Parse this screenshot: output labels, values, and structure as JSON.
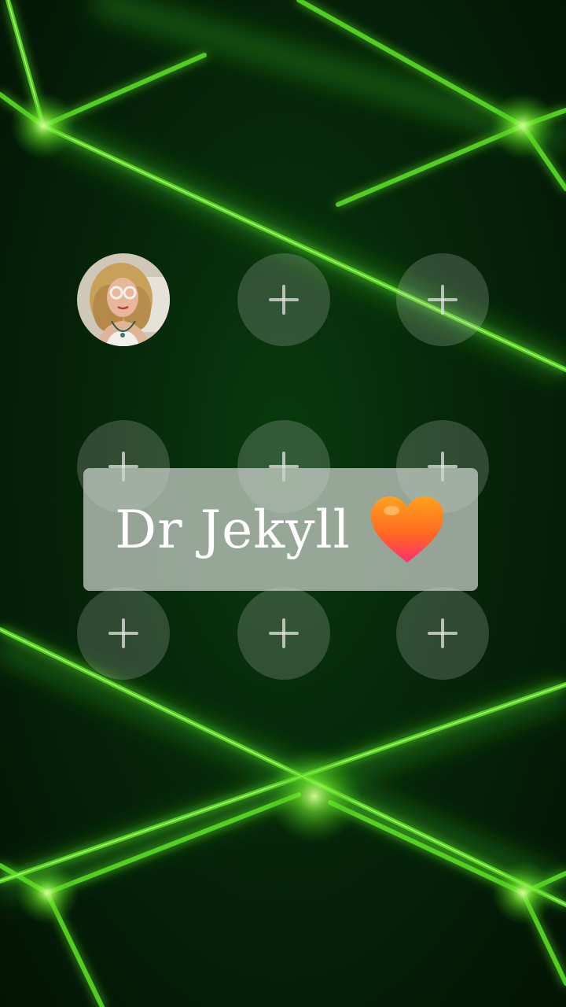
{
  "caption": {
    "text": "Dr Jekyll"
  },
  "icons": {
    "heart": "orange-heart-icon",
    "add": "plus-icon"
  },
  "colors": {
    "laser": "#5be026",
    "background": "#062609",
    "slot_fill": "rgba(200,210,200,0.22)",
    "caption_bg": "rgba(205,212,205,0.72)"
  },
  "grid": {
    "rows": 3,
    "columns": 3,
    "filled_slots": 1
  }
}
